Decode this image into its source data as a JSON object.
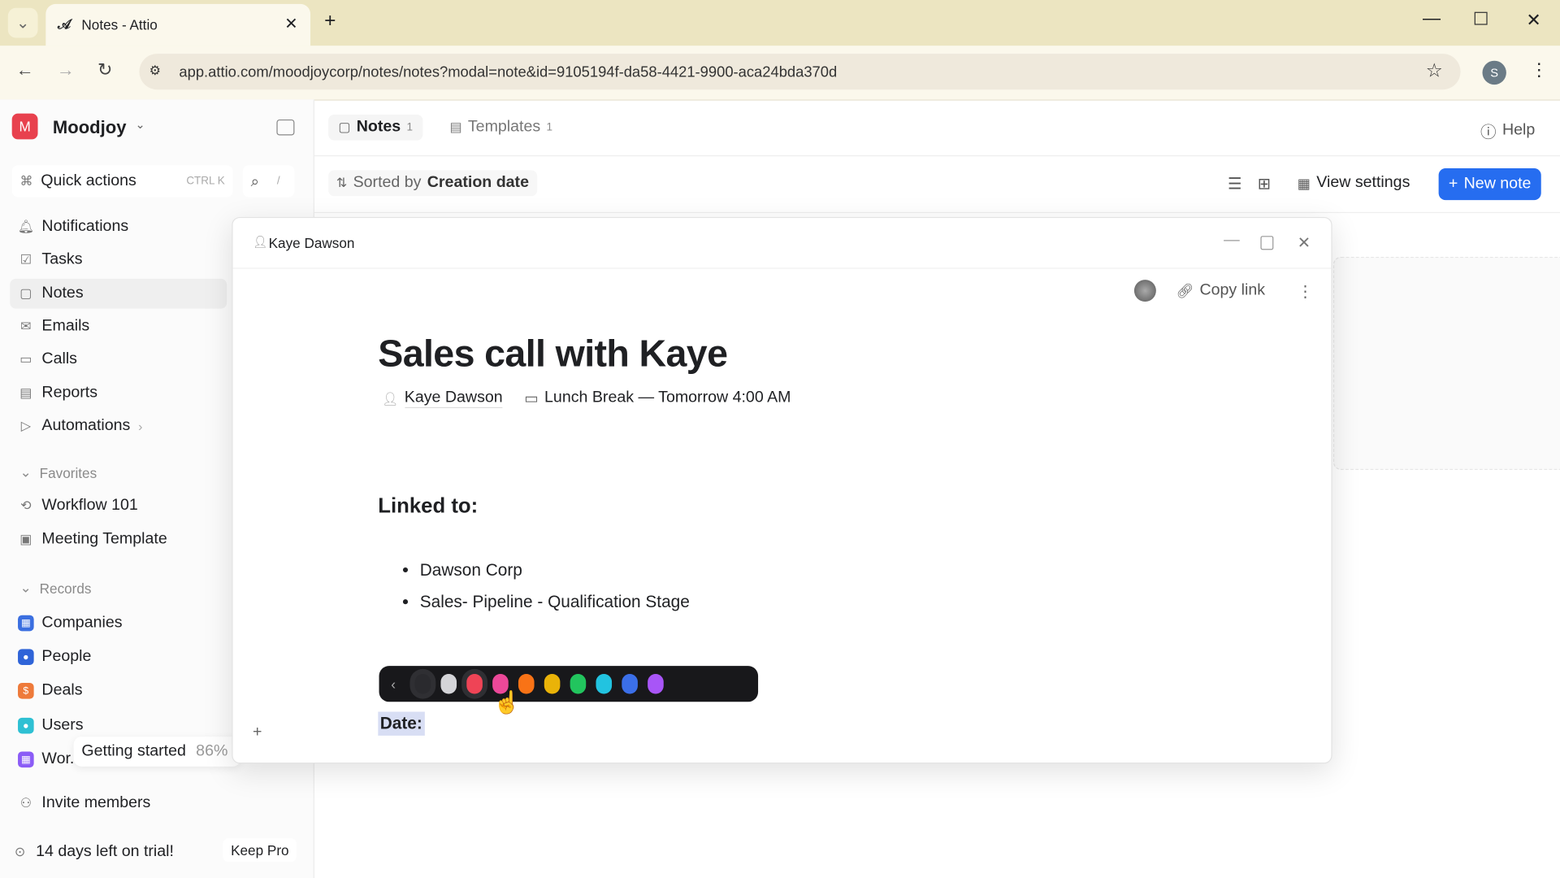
{
  "browser": {
    "tab_title": "Notes - Attio",
    "url": "app.attio.com/moodjoycorp/notes/notes?modal=note&id=9105194f-da58-4421-9900-aca24bda370d",
    "profile_initial": "S"
  },
  "workspace": {
    "name": "Moodjoy",
    "initial": "M"
  },
  "sidebar": {
    "quick_actions": "Quick actions",
    "shortcut": "CTRL K",
    "search_shortcut": "/",
    "items": [
      {
        "label": "Notifications"
      },
      {
        "label": "Tasks"
      },
      {
        "label": "Notes"
      },
      {
        "label": "Emails"
      },
      {
        "label": "Calls"
      },
      {
        "label": "Reports"
      },
      {
        "label": "Automations"
      }
    ],
    "favorites_label": "Favorites",
    "favorites": [
      {
        "label": "Workflow 101"
      },
      {
        "label": "Meeting Template"
      }
    ],
    "records_label": "Records",
    "records": [
      {
        "label": "Companies",
        "color": "#3b6fe0"
      },
      {
        "label": "People",
        "color": "#2f64d8"
      },
      {
        "label": "Deals",
        "color": "#ee7a3a"
      },
      {
        "label": "Users",
        "color": "#2ec0d3"
      },
      {
        "label": "Wor.",
        "color": "#8b5cf6"
      }
    ],
    "getting_started": "Getting started",
    "getting_started_pct": "86%",
    "invite": "Invite members",
    "trial": "14 days left on trial!",
    "keep_pro": "Keep Pro"
  },
  "header": {
    "tabs": [
      {
        "label": "Notes",
        "count": "1"
      },
      {
        "label": "Templates",
        "count": "1"
      }
    ],
    "help": "Help"
  },
  "toolbar": {
    "sorted_by": "Sorted by",
    "sort_field": "Creation date",
    "view_settings": "View settings",
    "new_note": "New note"
  },
  "modal": {
    "breadcrumb": "Kaye Dawson",
    "copy_link": "Copy link",
    "title": "Sales call with Kaye",
    "person": "Kaye Dawson",
    "meeting": "Lunch Break — Tomorrow 4:00 AM",
    "linked_heading": "Linked to:",
    "bullets": [
      "Dawson Corp",
      "Sales- Pipeline - Qualification Stage"
    ],
    "date_label": "Date:",
    "palette": [
      "#2a2a2e",
      "#d4d4d8",
      "#ef4456",
      "#ec4899",
      "#f97316",
      "#eab308",
      "#22c55e",
      "#22c3e0",
      "#3b6fe8",
      "#a855f7"
    ]
  }
}
